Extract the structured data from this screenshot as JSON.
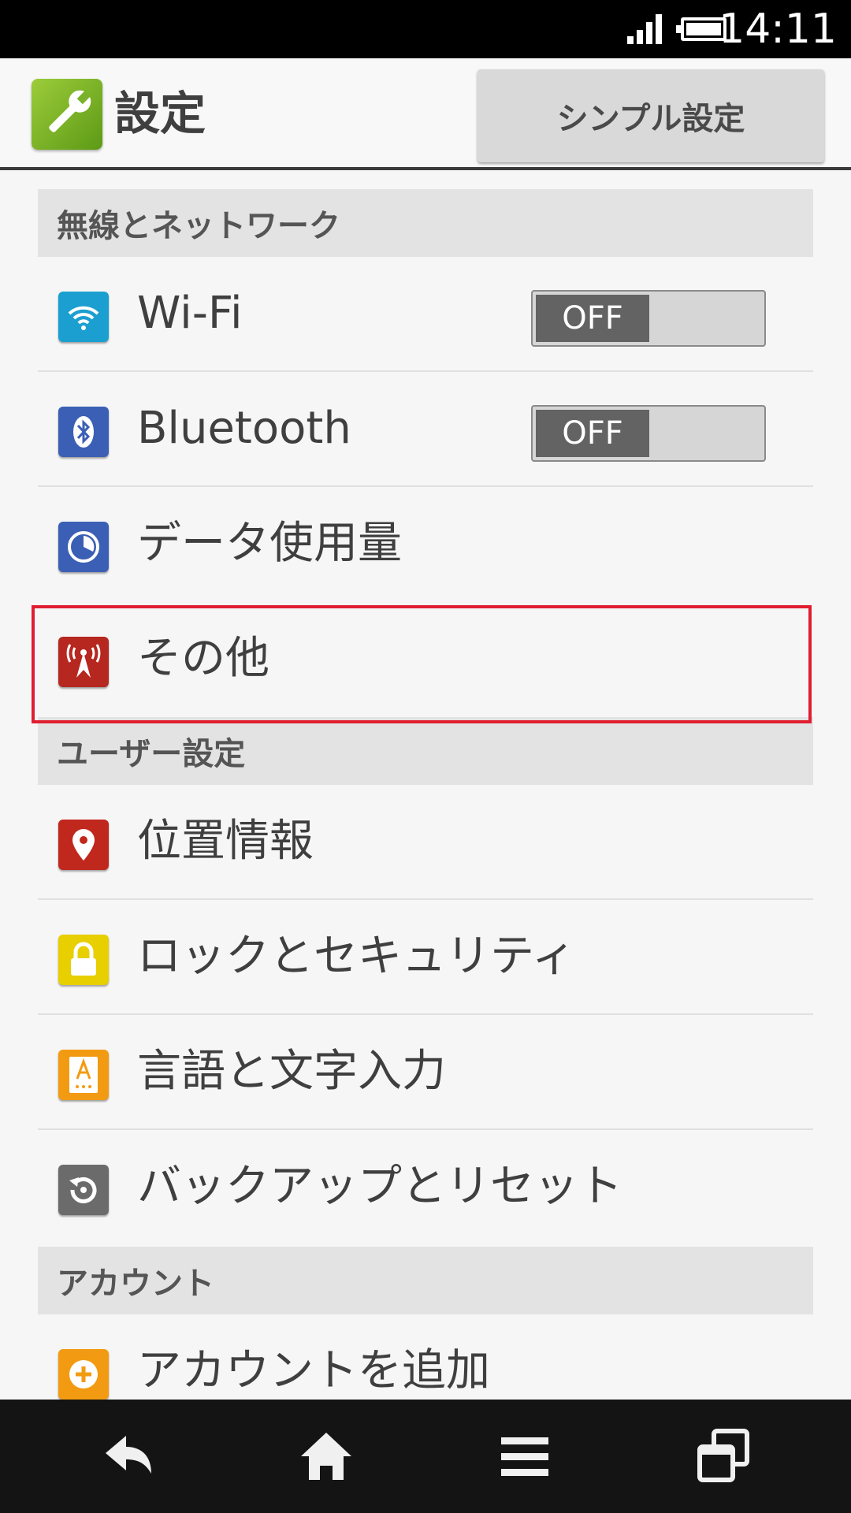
{
  "status_bar": {
    "time": "14:11",
    "signal_icon": "signal-icon",
    "battery_icon": "battery-icon"
  },
  "action_bar": {
    "title": "設定",
    "simple_settings_button": "シンプル設定",
    "app_icon": "wrench-icon"
  },
  "sections": [
    {
      "header": "無線とネットワーク",
      "items": [
        {
          "label": "Wi-Fi",
          "icon": "wifi-icon",
          "icon_color": "#1a9fd0",
          "toggle": "OFF"
        },
        {
          "label": "Bluetooth",
          "icon": "bluetooth-icon",
          "icon_color": "#3b5fb5",
          "toggle": "OFF"
        },
        {
          "label": "データ使用量",
          "icon": "data-usage-icon",
          "icon_color": "#3b5fb5"
        },
        {
          "label": "その他",
          "icon": "antenna-icon",
          "icon_color": "#b5271f"
        }
      ]
    },
    {
      "header": "ユーザー設定",
      "items": [
        {
          "label": "位置情報",
          "icon": "location-pin-icon",
          "icon_color": "#c0271d"
        },
        {
          "label": "ロックとセキュリティ",
          "icon": "lock-icon",
          "icon_color": "#e8cf00"
        },
        {
          "label": "言語と文字入力",
          "icon": "language-icon",
          "icon_color": "#f29b12"
        },
        {
          "label": "バックアップとリセット",
          "icon": "backup-icon",
          "icon_color": "#6b6b6b"
        }
      ]
    },
    {
      "header": "アカウント",
      "items": [
        {
          "label": "アカウントを追加",
          "icon": "add-account-icon",
          "icon_color": "#f29b12"
        }
      ]
    }
  ],
  "nav_bar": {
    "back": "back-icon",
    "home": "home-icon",
    "menu": "menu-icon",
    "recents": "recents-icon"
  }
}
